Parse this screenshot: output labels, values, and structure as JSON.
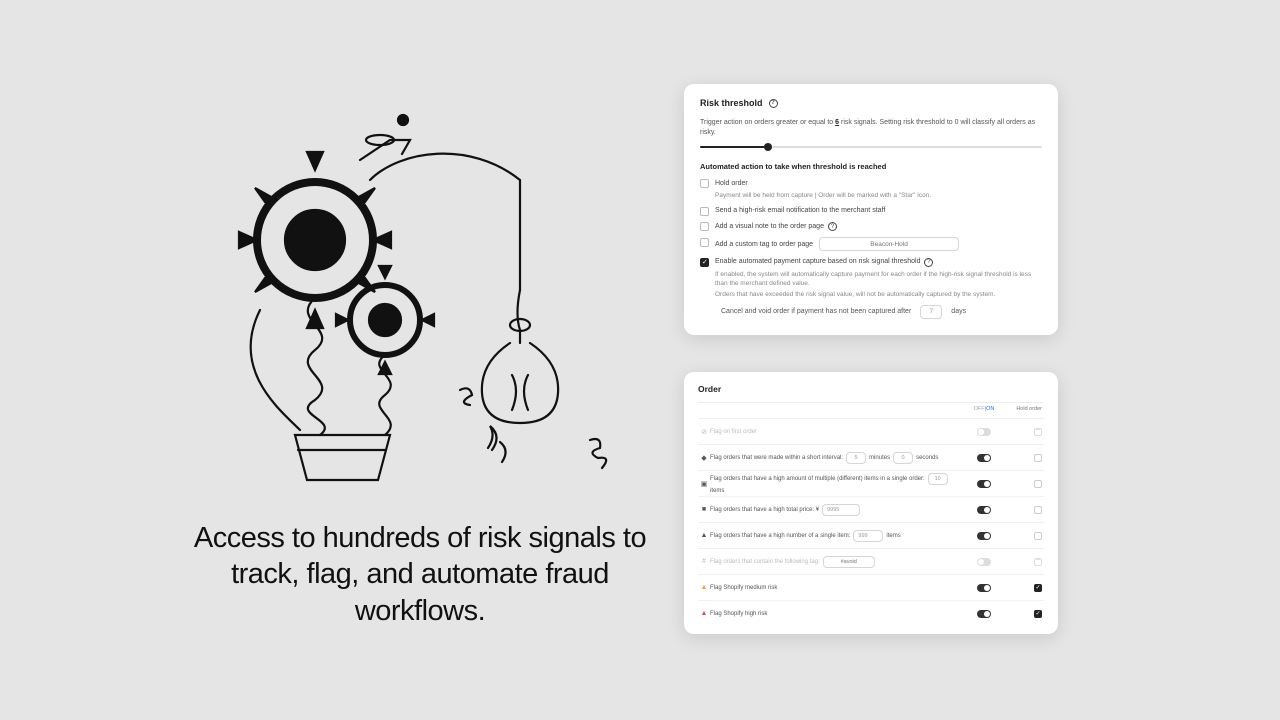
{
  "hero": {
    "text": "Access to hundreds of risk signals to track, flag, and automate fraud workflows."
  },
  "threshold": {
    "title": "Risk threshold",
    "desc_pre": "Trigger action on orders greater or equal to ",
    "value": "6",
    "desc_post": " risk signals. Setting risk threshold to 0 will classify all orders as risky.",
    "slider_percent": 20,
    "subhead": "Automated action to take when threshold is reached",
    "opt_hold": {
      "label": "Hold order",
      "sub": "Payment will be held from capture | Order will be marked with a \"Star\" Icon."
    },
    "opt_email": "Send a high-risk email notification to the merchant staff",
    "opt_visual": "Add a visual note to the order page",
    "opt_tag": {
      "label": "Add a custom tag to order page",
      "placeholder": "Beacon-Hold"
    },
    "opt_auto": {
      "label": "Enable automated payment capture based on risk signal threshold",
      "sub1": "If enabled, the system will automatically capture payment for each order if the high-risk signal threshold is less than the merchant defined value.",
      "sub2": "Orders that have exceeded the risk signal value, will not be automatically captured by the system.",
      "nested_label_pre": "Cancel and void order if payment has not been captured after",
      "days_value": "7",
      "nested_label_post": "days"
    }
  },
  "order": {
    "title": "Order",
    "head_offon_off": "OFF",
    "head_offon_sep": " | ",
    "head_offon_on": "ON",
    "head_hold": "Hold order",
    "rows": [
      {
        "icon": "⊘",
        "text": "Flag on first order",
        "dim": true,
        "hold": "dash"
      },
      {
        "icon": "◆",
        "text_pre": "Flag orders that were made within a short interval:",
        "v1": "5",
        "u1": "minutes",
        "v2": "0",
        "u2": "seconds",
        "hold": "no"
      },
      {
        "icon": "▣",
        "text_pre": "Flag orders that have a high amount of multiple (different) items in a single order:",
        "v1": "10",
        "u1": "items",
        "hold": "no"
      },
      {
        "icon": "■",
        "text_pre": "Flag orders that have a high total price: ¥",
        "v1": "9995",
        "wide": true,
        "hold": "no"
      },
      {
        "icon": "▲",
        "text_pre": "Flag orders that have a high number of a single item:",
        "v1": "999",
        "u1": "items",
        "med": true,
        "hold": "no"
      },
      {
        "icon": "#",
        "text_pre": "Flag orders that contain the following tag:",
        "tag": "#avoid",
        "dim": true,
        "hold": "dash"
      },
      {
        "icon": "▲",
        "icon_cls": "warn",
        "text": "Flag Shopify medium risk",
        "hold": "yes"
      },
      {
        "icon": "▲",
        "icon_cls": "danger",
        "text": "Flag Shopify high risk",
        "hold": "yes"
      }
    ]
  }
}
